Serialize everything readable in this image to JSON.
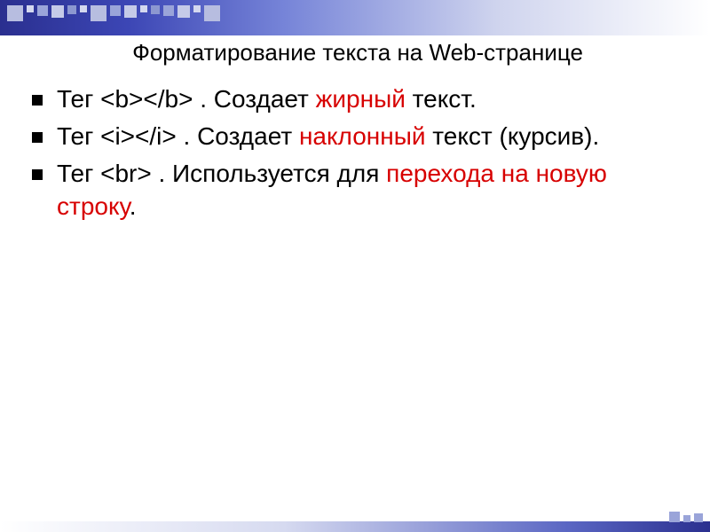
{
  "slide": {
    "title": "Форматирование текста на Web-странице",
    "bullets": [
      {
        "prefix": "Тег ",
        "tag": "<b></b>",
        "middle": " . Создает ",
        "highlight": "жирный",
        "suffix": " текст."
      },
      {
        "prefix": "Тег ",
        "tag": "<i></i>",
        "middle": " . Создает ",
        "highlight": "наклонный",
        "suffix": " текст (курсив)."
      },
      {
        "prefix": "Тег ",
        "tag": "<br>",
        "middle": " . Используется для ",
        "highlight": "перехода на новую строку",
        "suffix": "."
      }
    ]
  }
}
